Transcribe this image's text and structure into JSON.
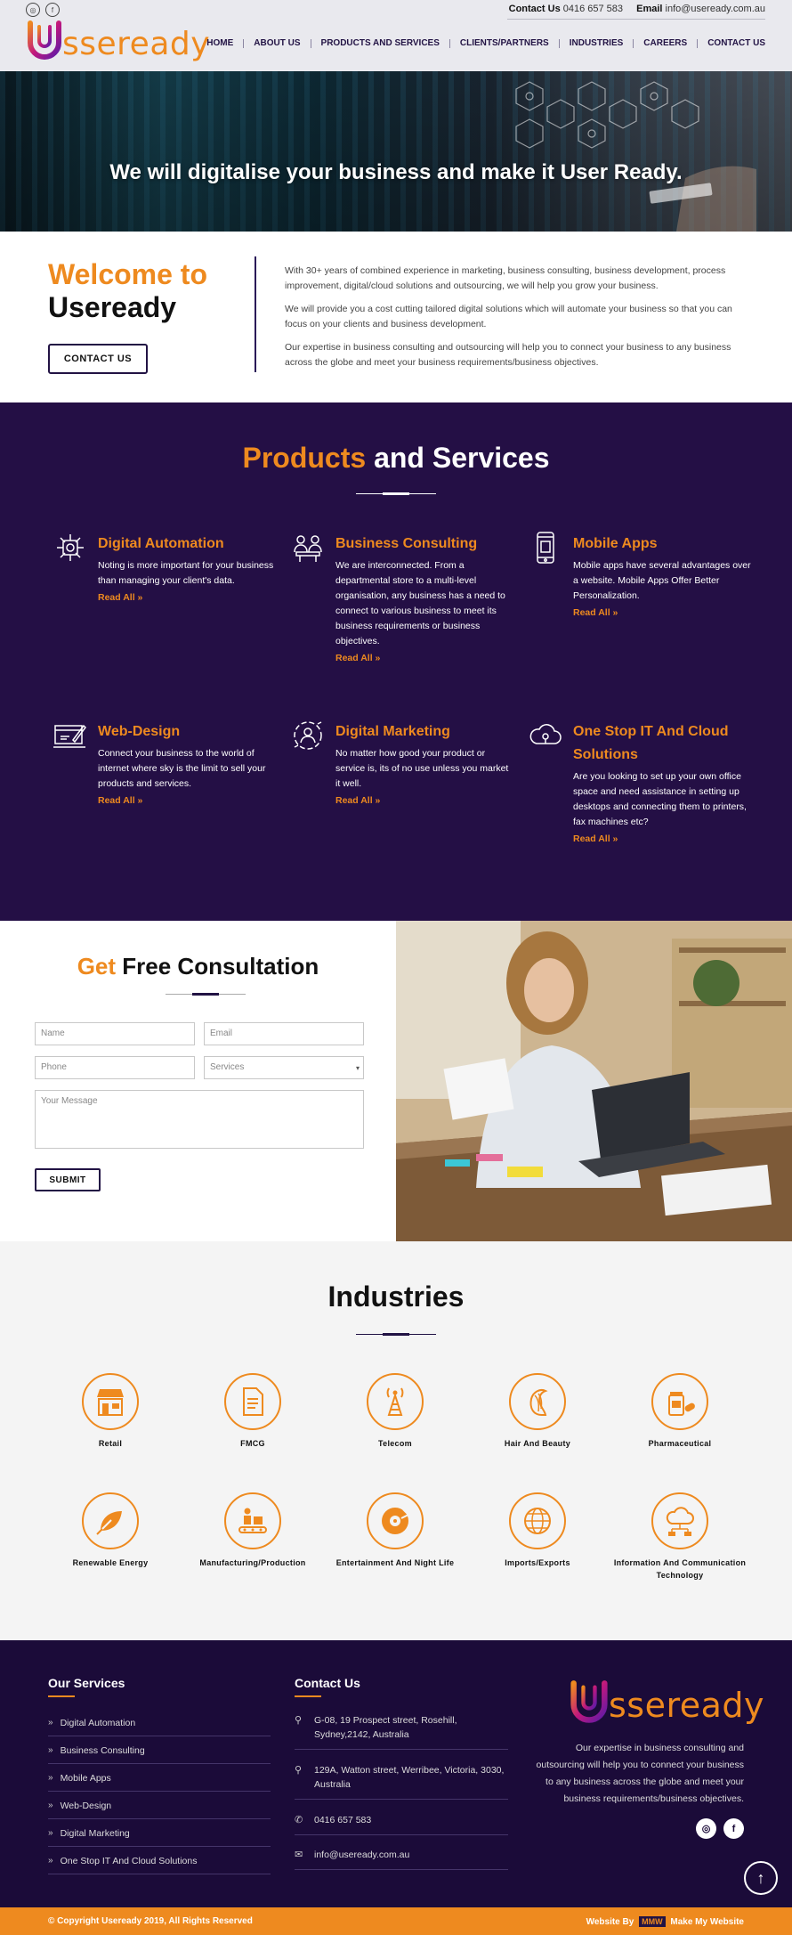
{
  "colors": {
    "accent": "#ee8a1f",
    "brand_dark": "#240f45",
    "footer_bg": "#1b0b39"
  },
  "header": {
    "logo_text": "sseready",
    "contact_label": "Contact Us",
    "contact_phone": "0416 657 583",
    "email_label": "Email",
    "email": "info@useready.com.au",
    "social": [
      "instagram-icon",
      "facebook-icon"
    ],
    "nav": [
      "HOME",
      "ABOUT US",
      "PRODUCTS AND SERVICES",
      "CLIENTS/PARTNERS",
      "INDUSTRIES",
      "CAREERS",
      "CONTACT US"
    ]
  },
  "hero": {
    "title": "We will digitalise your business and make it User Ready."
  },
  "welcome": {
    "title_orange": "Welcome to",
    "title_dark": "Useready",
    "button": "CONTACT US",
    "paragraphs": [
      "With 30+ years of combined experience in marketing, business consulting, business development, process improvement, digital/cloud solutions and outsourcing, we will help you grow your business.",
      "We will provide you a cost cutting tailored digital solutions which will automate your business so that you can focus on your clients and business development.",
      "Our expertise in business consulting and outsourcing will help you to connect your business to any business across the globe and meet your business requirements/business objectives."
    ]
  },
  "products": {
    "title_orange": "Products",
    "title_rest": " and Services",
    "read_all": "Read All »",
    "items": [
      {
        "title": "Digital Automation",
        "desc": "Noting is more important for your business than managing your client's data.",
        "icon": "automation-icon"
      },
      {
        "title": "Business Consulting",
        "desc": "We are interconnected. From a departmental store to a multi-level organisation, any business has a need to connect to various business to meet its business requirements or business objectives.",
        "icon": "consulting-icon"
      },
      {
        "title": "Mobile Apps",
        "desc": "Mobile apps have several advantages over a website. Mobile Apps Offer Better Personalization.",
        "icon": "mobile-icon"
      },
      {
        "title": "Web-Design",
        "desc": "Connect your business to the world of internet where sky is the limit to sell your products and services.",
        "icon": "web-design-icon"
      },
      {
        "title": "Digital Marketing",
        "desc": "No matter how good your product or service is, its of no use unless you market it well.",
        "icon": "marketing-icon"
      },
      {
        "title": "One Stop IT And Cloud Solutions",
        "desc": "Are you looking to set up your own office space and need assistance in setting up desktops and connecting them to printers, fax machines etc?",
        "icon": "cloud-icon"
      }
    ]
  },
  "consult": {
    "title_orange": "Get",
    "title_rest": " Free Consultation",
    "name_placeholder": "Name",
    "email_placeholder": "Email",
    "phone_placeholder": "Phone",
    "services_value": "Services",
    "message_placeholder": "Your Message",
    "submit": "SUBMIT"
  },
  "industries": {
    "title": "Industries",
    "items": [
      {
        "label": "Retail",
        "icon": "store-icon"
      },
      {
        "label": "FMCG",
        "icon": "document-icon"
      },
      {
        "label": "Telecom",
        "icon": "tower-icon"
      },
      {
        "label": "Hair And Beauty",
        "icon": "hair-icon"
      },
      {
        "label": "Pharmaceutical",
        "icon": "pills-icon"
      },
      {
        "label": "Renewable Energy",
        "icon": "leaf-plug-icon"
      },
      {
        "label": "Manufacturing/Production",
        "icon": "conveyor-icon"
      },
      {
        "label": "Entertainment And Night Life",
        "icon": "vinyl-icon"
      },
      {
        "label": "Imports/Exports",
        "icon": "globe-icon"
      },
      {
        "label": "Information And Communication Technology",
        "icon": "cloud-network-icon"
      }
    ]
  },
  "footer": {
    "services_title": "Our Services",
    "services": [
      "Digital Automation",
      "Business Consulting",
      "Mobile Apps",
      "Web-Design",
      "Digital Marketing",
      "One Stop IT And Cloud Solutions"
    ],
    "contact_title": "Contact Us",
    "contact": [
      {
        "icon": "map-pin-icon",
        "text": "G-08, 19 Prospect street, Rosehill, Sydney,2142, Australia"
      },
      {
        "icon": "map-pin-icon",
        "text": "129A, Watton street, Werribee, Victoria, 3030, Australia"
      },
      {
        "icon": "phone-icon",
        "text": "0416 657 583"
      },
      {
        "icon": "mail-icon",
        "text": "info@useready.com.au"
      }
    ],
    "logo_text": "sseready",
    "about": "Our expertise in business consulting and outsourcing will help you to connect your business to any business across the globe and meet your business requirements/business objectives.",
    "copyright": "© Copyright Useready 2019, All Rights Reserved",
    "credit_prefix": "Website By",
    "credit_badge": "MMW",
    "credit_suffix": "Make My Website"
  }
}
